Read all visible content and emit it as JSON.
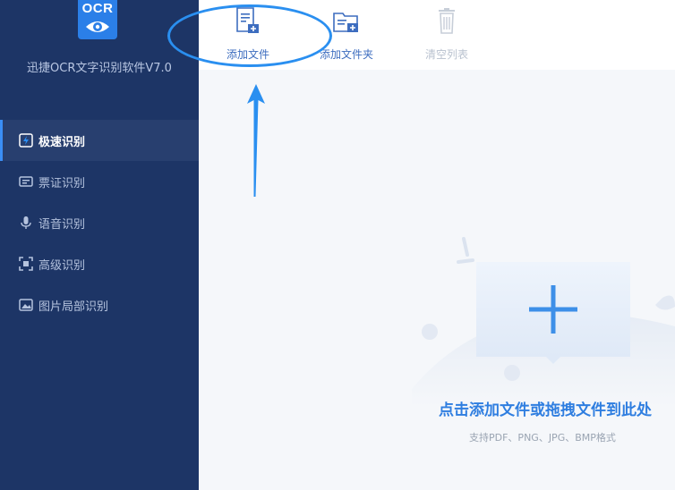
{
  "app": {
    "logo_text": "OCR",
    "title": "迅捷OCR文字识别软件V7.0"
  },
  "sidebar": {
    "items": [
      {
        "label": "极速识别",
        "icon": "lightning-icon"
      },
      {
        "label": "票证识别",
        "icon": "ticket-icon"
      },
      {
        "label": "语音识别",
        "icon": "microphone-icon"
      },
      {
        "label": "高级识别",
        "icon": "scan-frame-icon"
      },
      {
        "label": "图片局部识别",
        "icon": "image-crop-icon"
      }
    ]
  },
  "toolbar": {
    "add_file_label": "添加文件",
    "add_folder_label": "添加文件夹",
    "clear_list_label": "清空列表"
  },
  "dropzone": {
    "title": "点击添加文件或拖拽文件到此处",
    "subtitle": "支持PDF、PNG、JPG、BMP格式"
  },
  "colors": {
    "sidebar_bg": "#1d3566",
    "accent": "#2f7ee0",
    "annotation": "#2a8ff0"
  }
}
